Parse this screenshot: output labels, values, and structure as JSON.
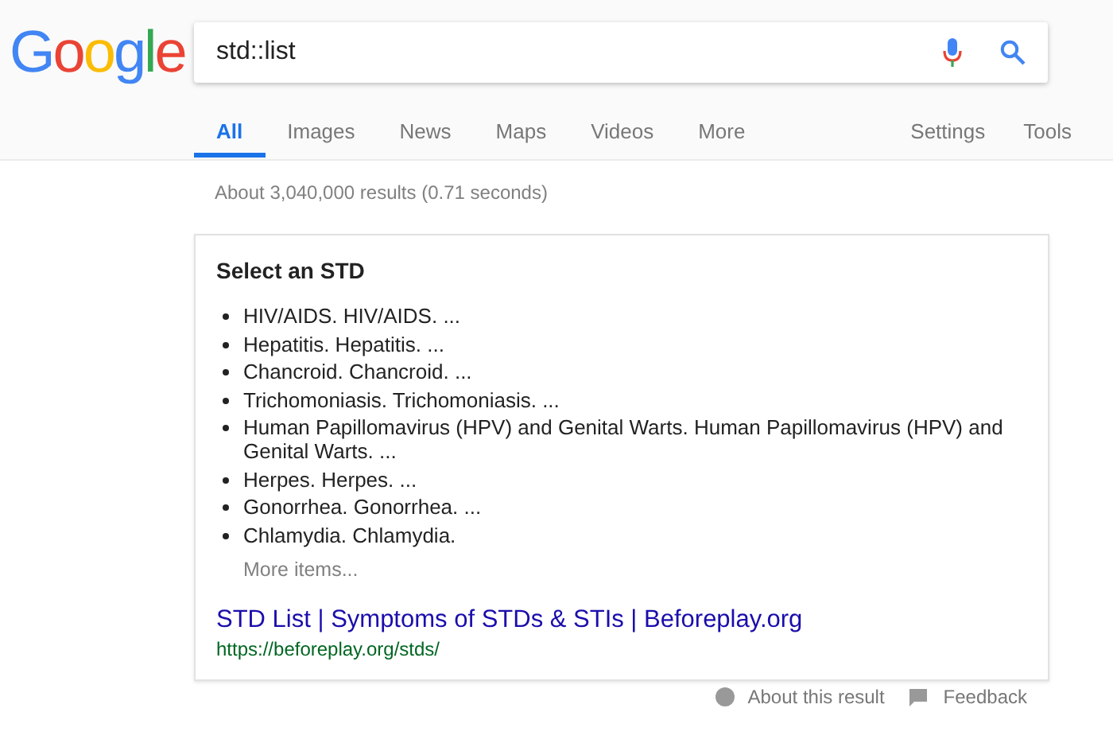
{
  "logo": "Google",
  "search": {
    "value": "std::list"
  },
  "tabs": [
    {
      "label": "All",
      "selected": true
    },
    {
      "label": "Images",
      "selected": false
    },
    {
      "label": "News",
      "selected": false
    },
    {
      "label": "Maps",
      "selected": false
    },
    {
      "label": "Videos",
      "selected": false
    },
    {
      "label": "More",
      "selected": false
    }
  ],
  "tools": [
    "Settings",
    "Tools"
  ],
  "result_stats": "About 3,040,000 results (0.71 seconds)",
  "snippet": {
    "heading": "Select an STD",
    "items": [
      "HIV/AIDS. HIV/AIDS. ...",
      "Hepatitis. Hepatitis. ...",
      "Chancroid. Chancroid. ...",
      "Trichomoniasis. Trichomoniasis. ...",
      "Human Papillomavirus (HPV) and Genital Warts. Human Papillomavirus (HPV) and Genital Warts. ...",
      "Herpes. Herpes. ...",
      "Gonorrhea. Gonorrhea. ...",
      "Chlamydia. Chlamydia."
    ],
    "more": "More items...",
    "link_title": "STD List | Symptoms of STDs & STIs | Beforeplay.org",
    "url": "https://beforeplay.org/stds/"
  },
  "footer": {
    "about": "About this result",
    "feedback": "Feedback"
  }
}
